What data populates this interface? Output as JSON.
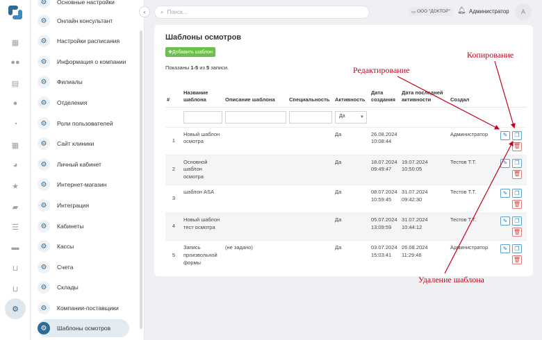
{
  "rail": {
    "icons": [
      "calendar-icon",
      "group-icon",
      "clipboard-icon",
      "user-icon",
      "clock-icon",
      "table-icon",
      "pie-chart-icon",
      "star-icon",
      "chat-icon",
      "list-icon",
      "handshake-icon",
      "cart-icon",
      "cart-return-icon",
      "settings-icon"
    ]
  },
  "menu": {
    "items": [
      {
        "label": "Основные настройки"
      },
      {
        "label": "Онлайн консультант"
      },
      {
        "label": "Настройки расписания"
      },
      {
        "label": "Информация о компании"
      },
      {
        "label": "Филиалы"
      },
      {
        "label": "Отделения"
      },
      {
        "label": "Роли пользователей"
      },
      {
        "label": "Сайт клиники"
      },
      {
        "label": "Личный кабинет"
      },
      {
        "label": "Интернет-магазин"
      },
      {
        "label": "Интеграция"
      },
      {
        "label": "Кабинеты"
      },
      {
        "label": "Кассы"
      },
      {
        "label": "Счета"
      },
      {
        "label": "Склады"
      },
      {
        "label": "Компании-поставщики"
      },
      {
        "label": "Шаблоны осмотров"
      }
    ]
  },
  "topbar": {
    "back": "‹",
    "search_placeholder": "Поиск...",
    "org": "ООО \"ДОКТОР\"",
    "user": "Администратор",
    "avatar": "A"
  },
  "page": {
    "title": "Шаблоны осмотров",
    "add_button": "Добавить шаблон",
    "shown_prefix": "Показаны ",
    "shown_range": "1-5",
    "shown_mid": " из ",
    "shown_total": "5",
    "shown_suffix": " записи."
  },
  "table": {
    "headers": [
      "#",
      "Название шаблона",
      "Описание шаблона",
      "Специальность",
      "Активность",
      "Дата создания",
      "Дата последней активности",
      "Создал"
    ],
    "filter_select": "Да",
    "rows": [
      {
        "num": "1",
        "name": "Новый шаблон осмотра",
        "desc": "",
        "spec": "",
        "active": "Да",
        "created": "26.08.2024 10:08:44",
        "last": "",
        "author": "Администратор"
      },
      {
        "num": "2",
        "name": "Основной шаблон осмотра",
        "desc": "",
        "spec": "",
        "active": "Да",
        "created": "18.07.2024 09:49:47",
        "last": "19.07.2024 10:50:05",
        "author": "Тестов Т.Т."
      },
      {
        "num": "3",
        "name": "шаблон ASA",
        "desc": "",
        "spec": "",
        "active": "Да",
        "created": "08.07.2024 10:59:45",
        "last": "31.07.2024 09:42:30",
        "author": "Тестов Т.Т."
      },
      {
        "num": "4",
        "name": "Новый шаблон тест осмотра",
        "desc": "",
        "spec": "",
        "active": "Да",
        "created": "05.07.2024 13:09:59",
        "last": "31.07.2024 10:44:12",
        "author": "Тестов Т.Т."
      },
      {
        "num": "5",
        "name": "Запись произвольной формы",
        "desc": "(не задано)",
        "spec": "",
        "active": "Да",
        "created": "03.07.2024 15:03:41",
        "last": "26.08.2024 11:29:46",
        "author": "Администратор"
      }
    ]
  },
  "annotations": {
    "edit": "Редактирование",
    "copy": "Копирование",
    "delete": "Удаление шаблона"
  },
  "colors": {
    "accent": "#2e6c96",
    "add_button": "#6cc04a",
    "annotation": "#c4001a",
    "delete": "#d24545"
  }
}
